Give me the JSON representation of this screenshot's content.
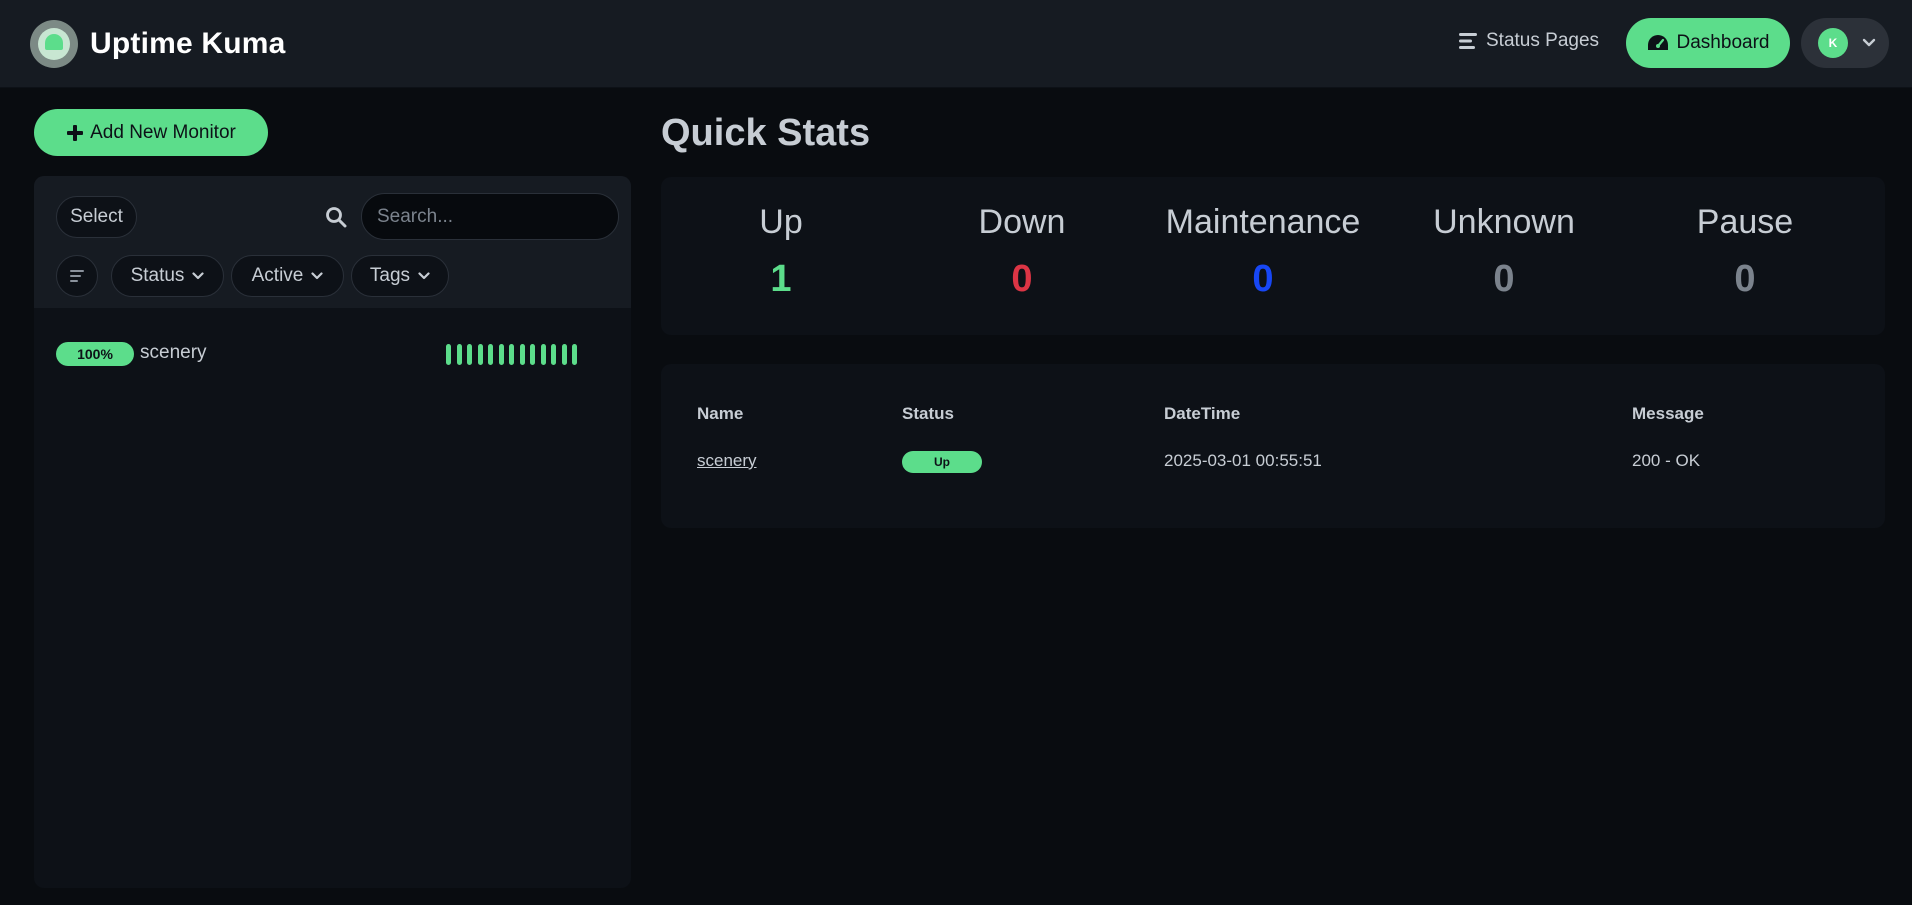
{
  "header": {
    "app_title": "Uptime Kuma",
    "status_pages_label": "Status Pages",
    "dashboard_label": "Dashboard",
    "avatar_initial": "K"
  },
  "sidebar": {
    "add_monitor_label": "Add New Monitor",
    "select_label": "Select",
    "search_placeholder": "Search...",
    "filters": {
      "status": "Status",
      "active": "Active",
      "tags": "Tags"
    },
    "monitors": [
      {
        "uptime": "100%",
        "name": "scenery",
        "heartbeats": 13
      }
    ]
  },
  "quick_stats": {
    "title": "Quick Stats",
    "items": [
      {
        "label": "Up",
        "value": "1",
        "color": "#5cdd8b"
      },
      {
        "label": "Down",
        "value": "0",
        "color": "#dc3545"
      },
      {
        "label": "Maintenance",
        "value": "0",
        "color": "#1747f5"
      },
      {
        "label": "Unknown",
        "value": "0",
        "color": "#7b838d"
      },
      {
        "label": "Pause",
        "value": "0",
        "color": "#7b838d"
      }
    ]
  },
  "events": {
    "headers": {
      "name": "Name",
      "status": "Status",
      "datetime": "DateTime",
      "message": "Message"
    },
    "rows": [
      {
        "name": "scenery",
        "status": "Up",
        "datetime": "2025-03-01 00:55:51",
        "message": "200 - OK"
      }
    ]
  },
  "colors": {
    "accent": "#5cdd8b",
    "header_bg": "#161b22",
    "page_bg": "#090c10",
    "card_bg": "#0d1117"
  }
}
